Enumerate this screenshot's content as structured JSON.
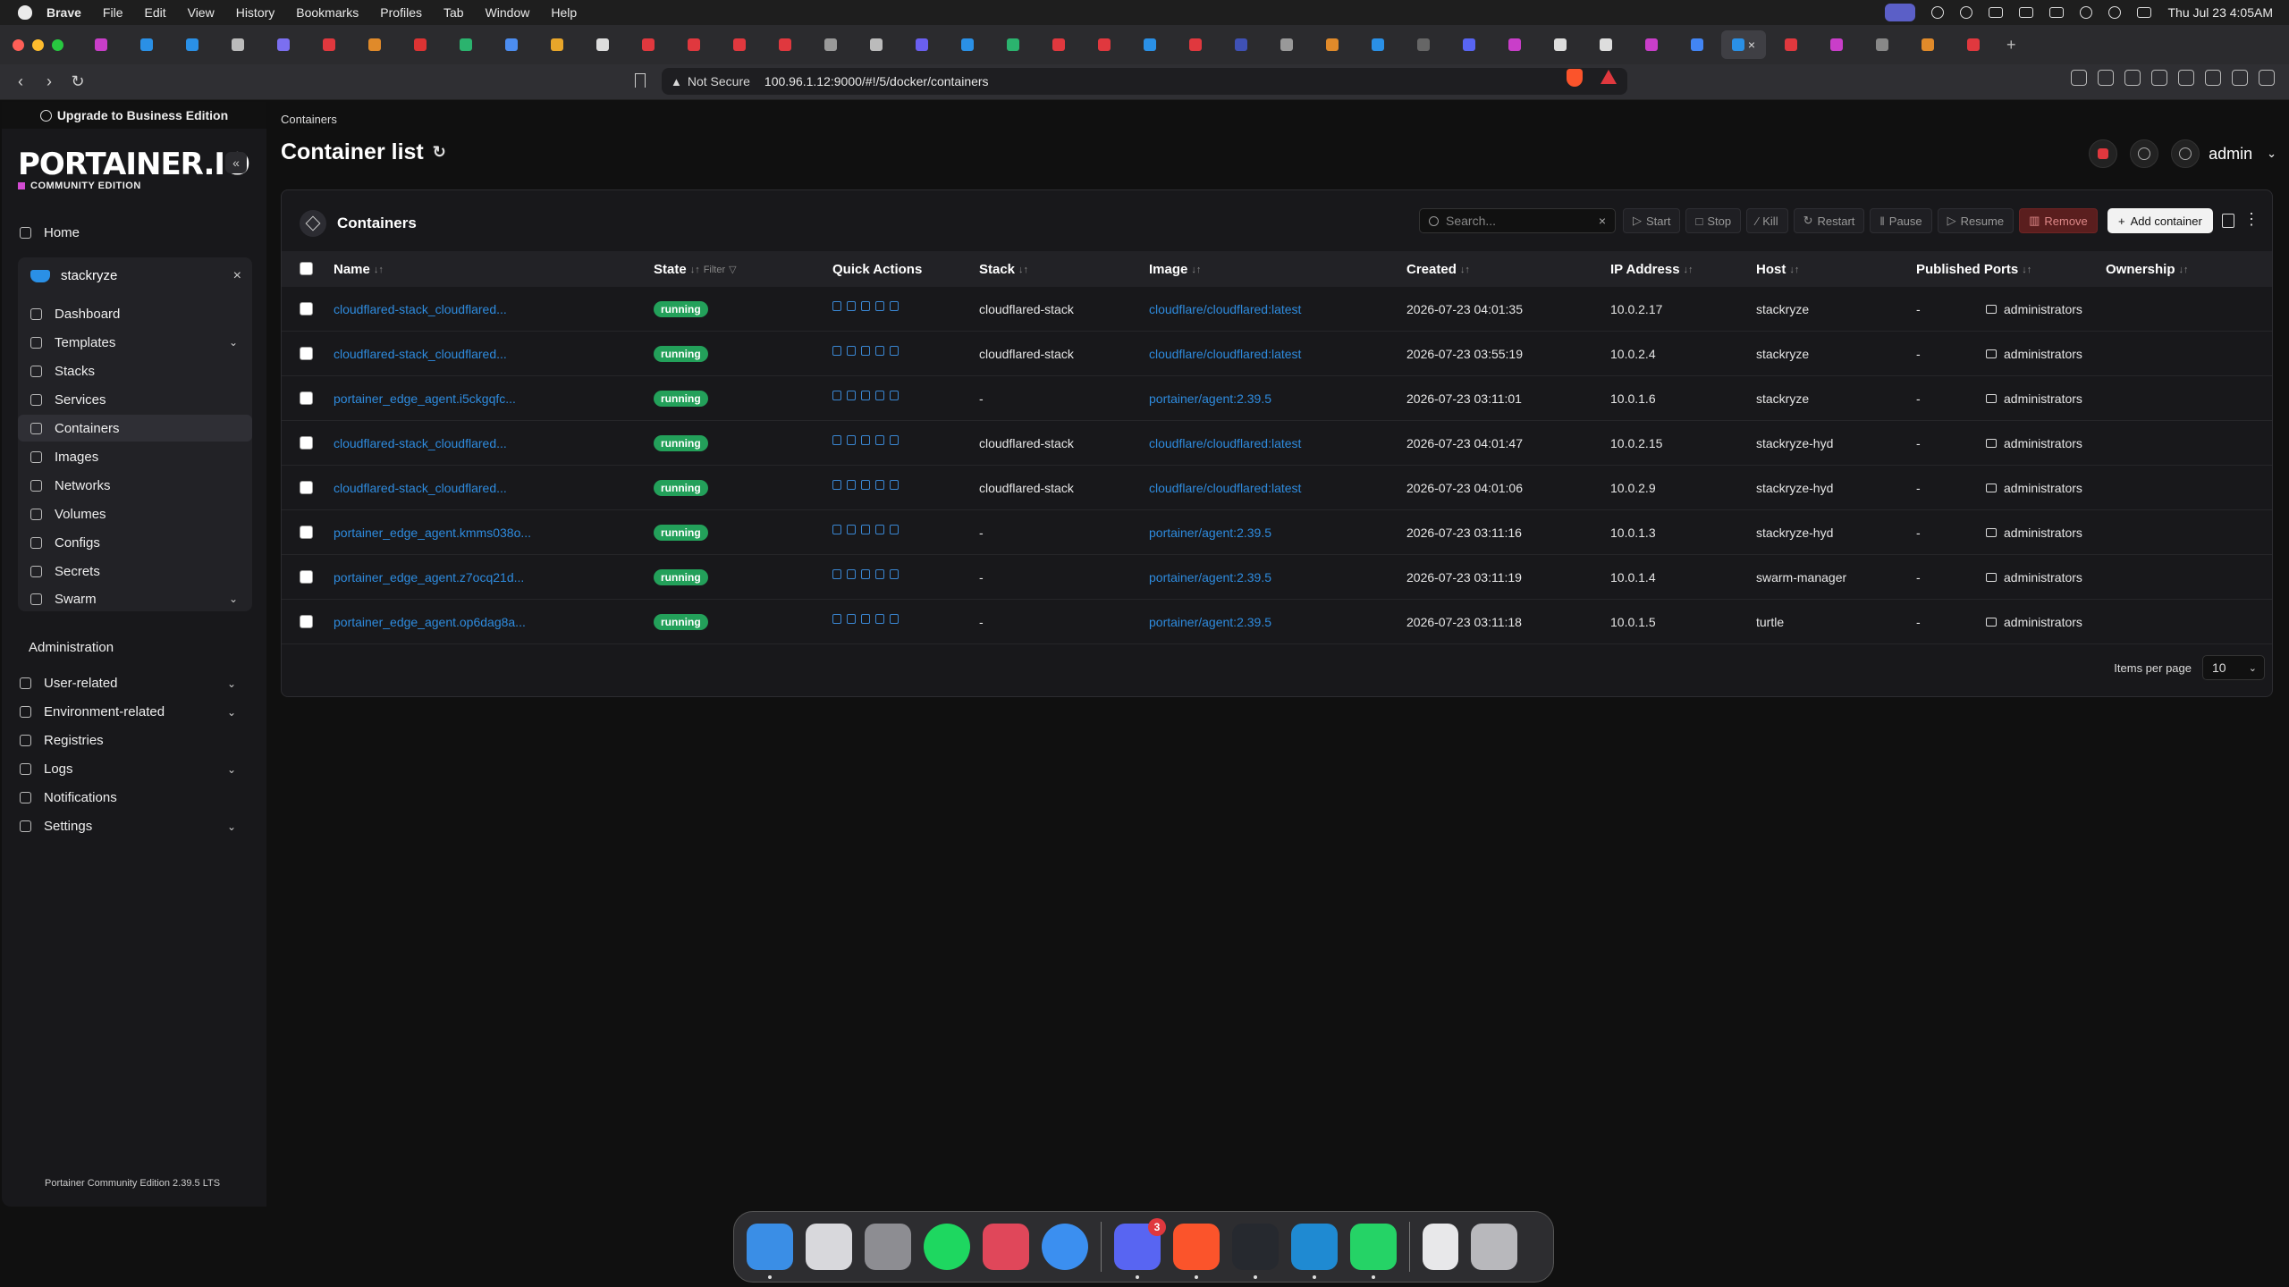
{
  "os_menubar": {
    "app": "Brave",
    "items": [
      "File",
      "Edit",
      "View",
      "History",
      "Bookmarks",
      "Profiles",
      "Tab",
      "Window",
      "Help"
    ],
    "clock": "Thu Jul 23  4:05AM"
  },
  "browser": {
    "security": "Not Secure",
    "url": "100.96.1.12:9000/#!/5/docker/containers"
  },
  "sidebar": {
    "upgrade": "Upgrade to Business Edition",
    "logo": "PORTAINER.IO",
    "edition": "COMMUNITY EDITION",
    "home": "Home",
    "env": {
      "name": "stackryze",
      "items": [
        "Dashboard",
        "Templates",
        "Stacks",
        "Services",
        "Containers",
        "Images",
        "Networks",
        "Volumes",
        "Configs",
        "Secrets",
        "Swarm"
      ]
    },
    "admin_heading": "Administration",
    "admin_items": [
      "User-related",
      "Environment-related",
      "Registries",
      "Logs",
      "Notifications",
      "Settings"
    ],
    "footer": "Portainer Community Edition 2.39.5 LTS"
  },
  "page": {
    "breadcrumb": "Containers",
    "title": "Container list",
    "user": "admin"
  },
  "card": {
    "title": "Containers",
    "search_placeholder": "Search...",
    "actions": [
      "Start",
      "Stop",
      "Kill",
      "Restart",
      "Pause",
      "Resume",
      "Remove"
    ],
    "add": "Add container"
  },
  "table": {
    "headers": [
      "Name",
      "State",
      "Quick Actions",
      "Stack",
      "Image",
      "Created",
      "IP Address",
      "Host",
      "Published Ports",
      "Ownership"
    ],
    "filter": "Filter",
    "rows": [
      {
        "name": "cloudflared-stack_cloudflared...",
        "state": "running",
        "stack": "cloudflared-stack",
        "image": "cloudflare/cloudflared:latest",
        "created": "2026-07-23 04:01:35",
        "ip": "10.0.2.17",
        "host": "stackryze",
        "ports": "-",
        "owner": "administrators"
      },
      {
        "name": "cloudflared-stack_cloudflared...",
        "state": "running",
        "stack": "cloudflared-stack",
        "image": "cloudflare/cloudflared:latest",
        "created": "2026-07-23 03:55:19",
        "ip": "10.0.2.4",
        "host": "stackryze",
        "ports": "-",
        "owner": "administrators"
      },
      {
        "name": "portainer_edge_agent.i5ckgqfc...",
        "state": "running",
        "stack": "-",
        "image": "portainer/agent:2.39.5",
        "created": "2026-07-23 03:11:01",
        "ip": "10.0.1.6",
        "host": "stackryze",
        "ports": "-",
        "owner": "administrators"
      },
      {
        "name": "cloudflared-stack_cloudflared...",
        "state": "running",
        "stack": "cloudflared-stack",
        "image": "cloudflare/cloudflared:latest",
        "created": "2026-07-23 04:01:47",
        "ip": "10.0.2.15",
        "host": "stackryze-hyd",
        "ports": "-",
        "owner": "administrators"
      },
      {
        "name": "cloudflared-stack_cloudflared...",
        "state": "running",
        "stack": "cloudflared-stack",
        "image": "cloudflare/cloudflared:latest",
        "created": "2026-07-23 04:01:06",
        "ip": "10.0.2.9",
        "host": "stackryze-hyd",
        "ports": "-",
        "owner": "administrators"
      },
      {
        "name": "portainer_edge_agent.kmms038o...",
        "state": "running",
        "stack": "-",
        "image": "portainer/agent:2.39.5",
        "created": "2026-07-23 03:11:16",
        "ip": "10.0.1.3",
        "host": "stackryze-hyd",
        "ports": "-",
        "owner": "administrators"
      },
      {
        "name": "portainer_edge_agent.z7ocq21d...",
        "state": "running",
        "stack": "-",
        "image": "portainer/agent:2.39.5",
        "created": "2026-07-23 03:11:19",
        "ip": "10.0.1.4",
        "host": "swarm-manager",
        "ports": "-",
        "owner": "administrators"
      },
      {
        "name": "portainer_edge_agent.op6dag8a...",
        "state": "running",
        "stack": "-",
        "image": "portainer/agent:2.39.5",
        "created": "2026-07-23 03:11:18",
        "ip": "10.0.1.5",
        "host": "turtle",
        "ports": "-",
        "owner": "administrators"
      }
    ],
    "items_per_page_label": "Items per page",
    "items_per_page": "10"
  },
  "dock": {
    "discord_badge": "3"
  },
  "colors": {
    "accent": "#2e8bde",
    "running": "#23a05a",
    "remove": "#6e2424",
    "brand": "#d24bd2"
  }
}
